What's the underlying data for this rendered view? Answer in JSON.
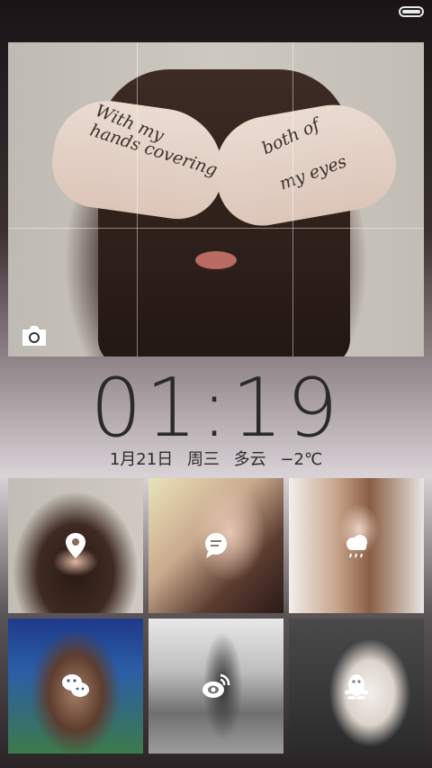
{
  "status_bar": {
    "battery_icon": "battery-full-icon"
  },
  "photo": {
    "handwriting": [
      "With my",
      "hands covering",
      "both of",
      "my eyes"
    ],
    "camera_icon": "camera-icon"
  },
  "clock": {
    "time": "01:19",
    "date": "1月21日",
    "weekday": "周三",
    "weather": "多云",
    "temperature": "−2℃"
  },
  "shortcuts": [
    {
      "icon": "location-pin-icon"
    },
    {
      "icon": "chat-bubble-icon"
    },
    {
      "icon": "weather-cloud-icon"
    },
    {
      "icon": "wechat-icon"
    },
    {
      "icon": "weibo-icon"
    },
    {
      "icon": "qq-penguin-icon"
    }
  ]
}
